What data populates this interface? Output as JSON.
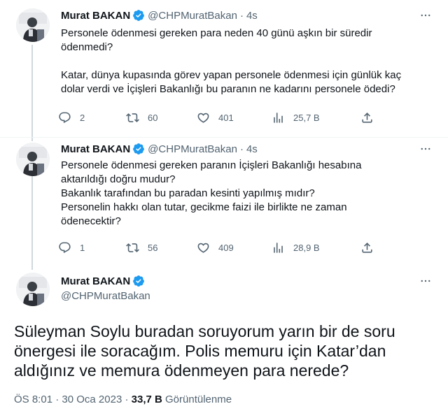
{
  "tweets": [
    {
      "name": "Murat BAKAN",
      "handle": "@CHPMuratBakan",
      "separator": "·",
      "time": "4s",
      "lines": [
        "Personele ödenmesi gereken para neden 40 günü aşkın bir süredir",
        "ödenmedi?",
        "",
        "Katar, dünya kupasında görev yapan personele ödenmesi için günlük kaç",
        "dolar verdi ve  İçişleri Bakanlığı bu paranın ne kadarını personele ödedi?"
      ],
      "replies": "2",
      "retweets": "60",
      "likes": "401",
      "views": "25,7 B"
    },
    {
      "name": "Murat BAKAN",
      "handle": "@CHPMuratBakan",
      "separator": "·",
      "time": "4s",
      "lines": [
        "Personele ödenmesi gereken paranın İçişleri Bakanlığı hesabına",
        "aktarıldığı doğru mudur?",
        "Bakanlık tarafından bu paradan kesinti yapılmış mıdır?",
        "Personelin hakkı olan tutar, gecikme faizi ile birlikte ne zaman",
        "ödenecektir?"
      ],
      "replies": "1",
      "retweets": "56",
      "likes": "409",
      "views": "28,9 B"
    }
  ],
  "main_tweet": {
    "name": "Murat BAKAN",
    "handle": "@CHPMuratBakan",
    "lines": [
      "Süleyman Soylu buradan soruyorum yarın bir de soru",
      "önergesi ile soracağım. Polis memuru için Katar’dan",
      "aldığınız ve memura ödenmeyen para nerede?"
    ],
    "time": "ÖS 8:01",
    "dot": "·",
    "date": "30 Oca 2023",
    "dot2": "·",
    "views_count": "33,7 B",
    "views_label": "Görüntülenme"
  },
  "icons": {
    "more": "more-horizontal-icon",
    "reply": "reply-icon",
    "retweet": "retweet-icon",
    "like": "heart-icon",
    "views": "views-icon",
    "share": "share-icon",
    "verified": "verified-badge-icon"
  },
  "colors": {
    "verified": "#1d9bf0",
    "muted": "#536471",
    "text": "#0f1419",
    "thread_line": "#cfd9de"
  }
}
